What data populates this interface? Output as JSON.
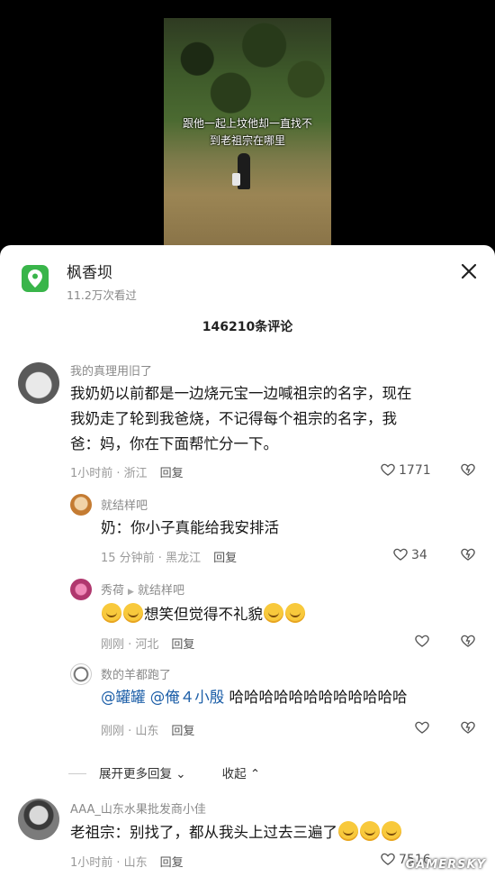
{
  "video": {
    "subtitle_line1": "跟他一起上坟他却一直找不",
    "subtitle_line2": "到老祖宗在哪里"
  },
  "header": {
    "place_icon": "location-pin-icon",
    "place_name": "枫香坝",
    "views": "11.2万次看过",
    "close_icon": "close-icon"
  },
  "comment_count": "146210条评论",
  "comments": [
    {
      "author": "我的真理用旧了",
      "lines": [
        "我奶奶以前都是一边烧元宝一边喊祖宗的名字，现在",
        "我奶走了轮到我爸烧，不记得每个祖宗的名字，我",
        "爸：妈，你在下面帮忙分一下。"
      ],
      "time_location": "1小时前 · 浙江",
      "reply_label": "回复",
      "likes": "1771"
    },
    {
      "author": "就结样吧",
      "text": "奶：你小子真能给我安排活",
      "time_location": "15 分钟前 · 黑龙江",
      "reply_label": "回复",
      "likes": "34"
    },
    {
      "author": "秀荷",
      "reply_to": "就结样吧",
      "text": "想笑但觉得不礼貌",
      "time_location": "刚刚 · 河北",
      "reply_label": "回复",
      "likes": ""
    },
    {
      "author": "数的羊都跑了",
      "mention1": "@罐罐",
      "mention2": "@俺４小殷",
      "text": "哈哈哈哈哈哈哈哈哈哈哈哈",
      "time_location": "刚刚 · 山东",
      "reply_label": "回复",
      "likes": ""
    },
    {
      "author": "AAA_山东水果批发商小佳",
      "text": "老祖宗：别找了，都从我头上过去三遍了",
      "time_location": "1小时前 · 山东",
      "reply_label": "回复",
      "likes": "7516"
    }
  ],
  "expand_more": "展开更多回复",
  "collapse": "收起",
  "watermark": "GAMERSKY",
  "colors": {
    "accent_green": "#39b54a",
    "mention_blue": "#1d5fa8"
  }
}
